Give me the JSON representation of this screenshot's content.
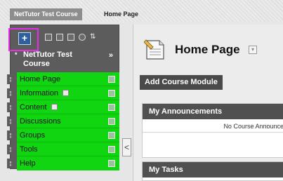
{
  "breadcrumb": {
    "course": "NetTutor Test Course",
    "page": "Home Page"
  },
  "toolbar": {
    "add_symbol": "+",
    "icons": [
      "add-icon",
      "list-icon",
      "folder-icon",
      "window-icon",
      "refresh-icon",
      "sort-icon"
    ],
    "sort_symbol": "⇅"
  },
  "course": {
    "star": "*",
    "title_line1": "NetTutor Test",
    "title_line2": "Course",
    "collapse": "»"
  },
  "menu": {
    "items": [
      {
        "label": "Home Page"
      },
      {
        "label": "Information"
      },
      {
        "label": "Content"
      },
      {
        "label": "Discussions"
      },
      {
        "label": "Groups"
      },
      {
        "label": "Tools"
      },
      {
        "label": "Help"
      }
    ],
    "grip_symbol": "↕"
  },
  "side_toggle": "<",
  "main": {
    "title": "Home Page",
    "add_module_label": "Add Course Module",
    "announcements": {
      "title": "My Announcements",
      "body": "No Course Announce"
    },
    "tasks": {
      "title": "My Tasks"
    }
  },
  "colors": {
    "menu_green": "#10d510",
    "highlight_magenta": "#e52de5",
    "add_blue": "#2f5f9f"
  }
}
